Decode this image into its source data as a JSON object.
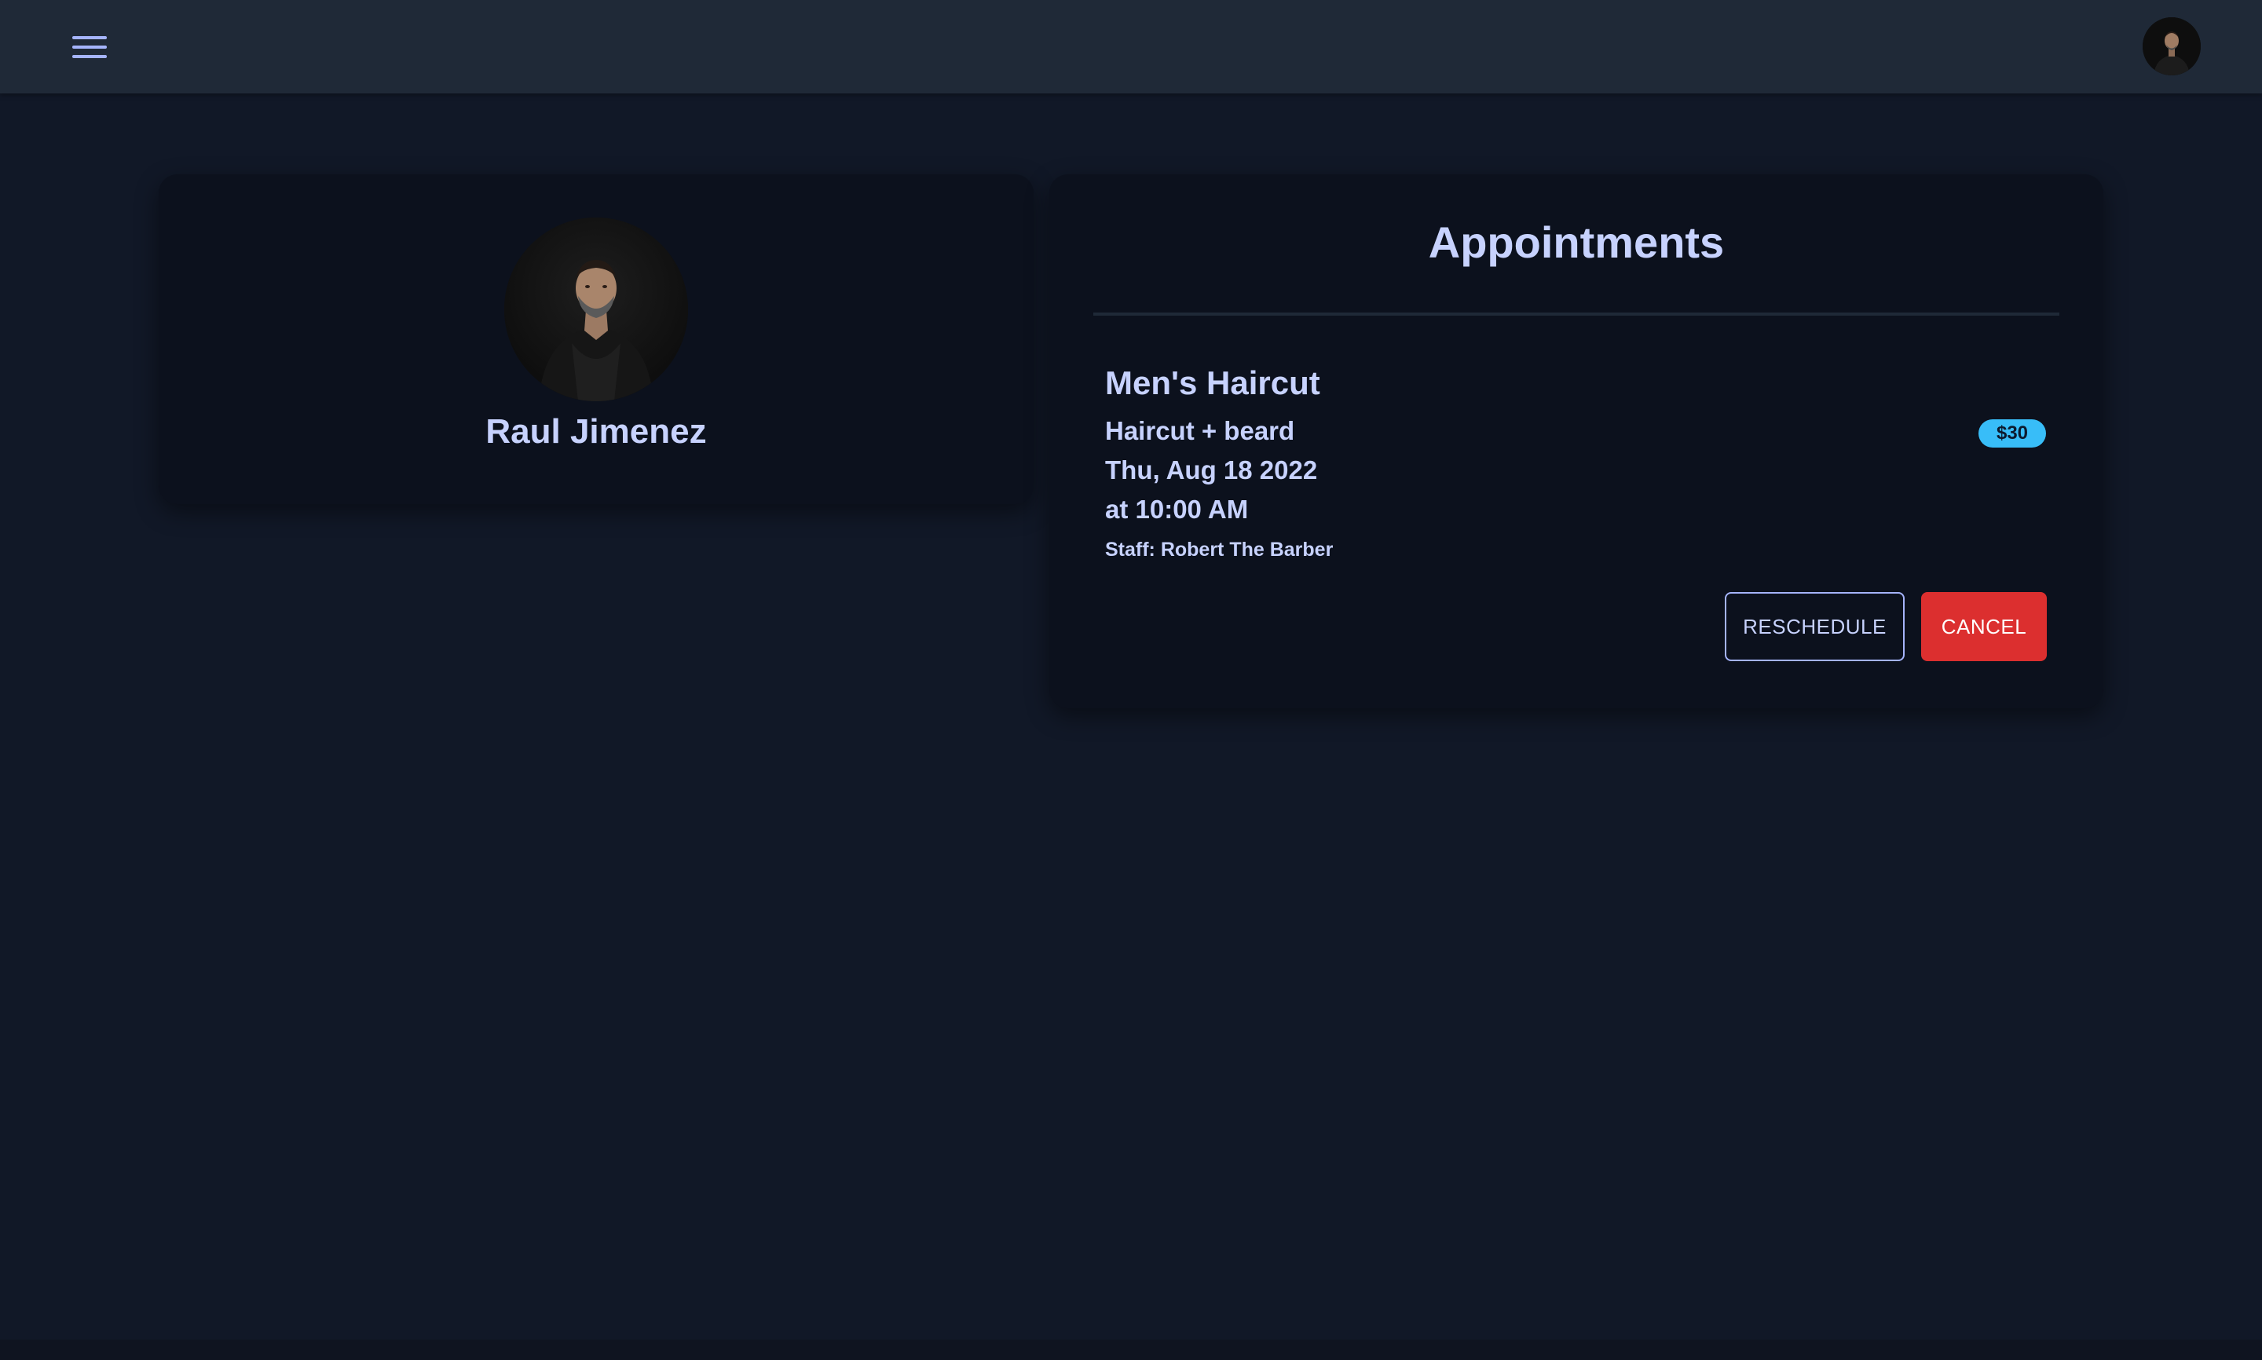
{
  "topbar": {
    "menu_icon": "hamburger-menu-icon",
    "avatar_alt": "User avatar"
  },
  "profile": {
    "name": "Raul Jimenez",
    "avatar_alt": "Raul Jimenez profile photo"
  },
  "appointments": {
    "title": "Appointments",
    "items": [
      {
        "service": "Men's Haircut",
        "description": "Haircut + beard",
        "date": "Thu, Aug 18 2022",
        "time": "at 10:00 AM",
        "staff": "Staff: Robert The Barber",
        "price": "$30",
        "reschedule_label": "RESCHEDULE",
        "cancel_label": "CANCEL"
      }
    ]
  },
  "colors": {
    "background": "#111827",
    "topbar": "#1f2937",
    "card": "#0c111d",
    "text": "#c7d2fe",
    "price_badge": "#38bdf8",
    "cancel_button": "#dc2f2f"
  }
}
